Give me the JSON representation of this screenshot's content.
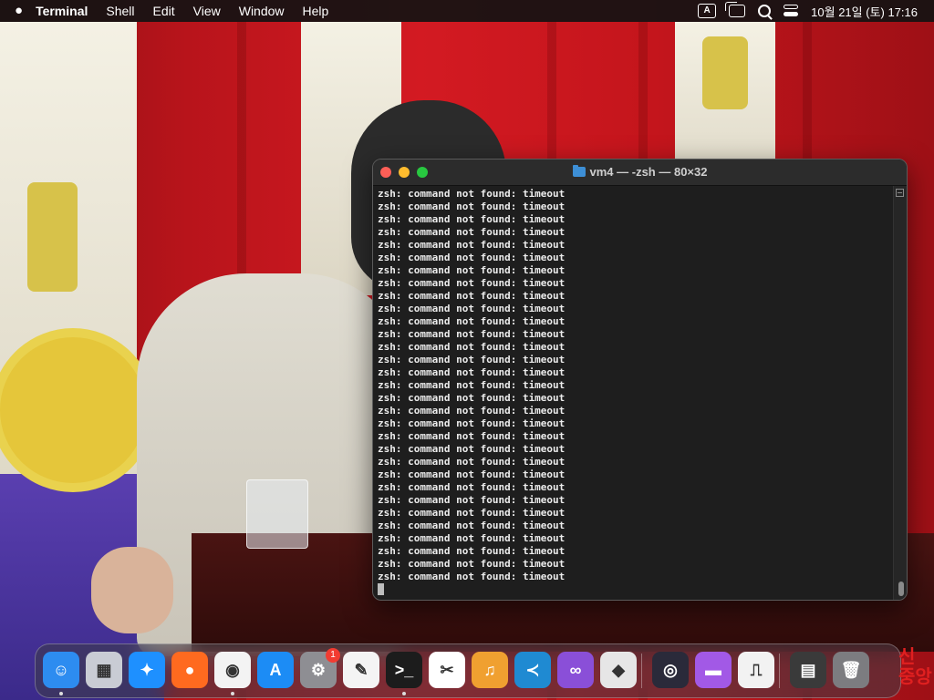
{
  "menubar": {
    "app_name": "Terminal",
    "items": [
      "Shell",
      "Edit",
      "View",
      "Window",
      "Help"
    ],
    "input_source": "A",
    "clock": "10월 21일 (토)  17:16"
  },
  "terminal": {
    "title": "vm4 — -zsh — 80×32",
    "line_text": "zsh: command not found: timeout",
    "line_count": 31
  },
  "dock": {
    "apps": [
      {
        "name": "Finder",
        "glyph": "☺",
        "color": "#2d8cf0",
        "running": true
      },
      {
        "name": "Launchpad",
        "glyph": "▦",
        "color": "#c9ccd4",
        "running": false
      },
      {
        "name": "Safari",
        "glyph": "✦",
        "color": "#1e90ff",
        "running": false
      },
      {
        "name": "Firefox",
        "glyph": "●",
        "color": "#ff6a1f",
        "running": false
      },
      {
        "name": "Chrome",
        "glyph": "◉",
        "color": "#f3f3f3",
        "running": true
      },
      {
        "name": "App Store",
        "glyph": "A",
        "color": "#1c8cf5",
        "running": false
      },
      {
        "name": "System Settings",
        "glyph": "⚙",
        "color": "#8e8e93",
        "running": false,
        "badge": "1"
      },
      {
        "name": "TextEdit",
        "glyph": "✎",
        "color": "#f4f4f4",
        "running": false
      },
      {
        "name": "Terminal",
        "glyph": ">_",
        "color": "#1c1c1c",
        "running": true
      },
      {
        "name": "CapCut",
        "glyph": "✂",
        "color": "#ffffff",
        "running": false
      },
      {
        "name": "GarageBand",
        "glyph": "♫",
        "color": "#f0a030",
        "running": false
      },
      {
        "name": "VS Code",
        "glyph": "≺",
        "color": "#1f8ad2",
        "running": false
      },
      {
        "name": "Visual Studio",
        "glyph": "∞",
        "color": "#8a4fd8",
        "running": false
      },
      {
        "name": "Roblox",
        "glyph": "◆",
        "color": "#e6e6e6",
        "running": false
      },
      {
        "name": "OBS",
        "glyph": "◎",
        "color": "#2a2a3a",
        "running": false
      },
      {
        "name": "Storage",
        "glyph": "▬",
        "color": "#a259e6",
        "running": false
      },
      {
        "name": "System Info",
        "glyph": "⎍",
        "color": "#f2f2f2",
        "running": false
      },
      {
        "name": "Downloads",
        "glyph": "▤",
        "color": "#3a3a3a",
        "running": false
      },
      {
        "name": "Trash",
        "glyph": "🗑",
        "color": "#7c7c80",
        "running": false
      }
    ]
  }
}
